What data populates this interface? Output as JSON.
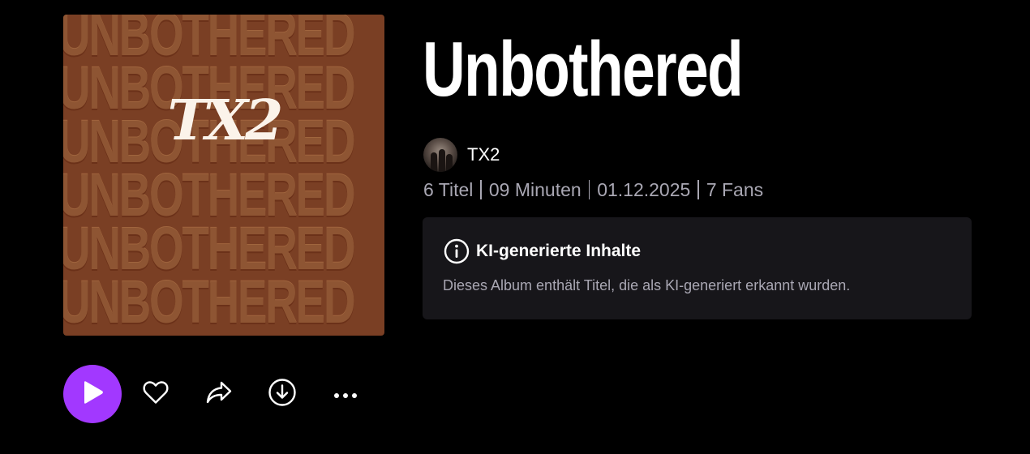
{
  "cover": {
    "pattern_word": "UNBOTHERED",
    "logo_text": "TX2",
    "background_color": "#7a3f24"
  },
  "album": {
    "title": "Unbothered"
  },
  "artist": {
    "name": "TX2"
  },
  "meta": {
    "tracks": "6 Titel",
    "duration": "09 Minuten",
    "release_date": "01.12.2025",
    "fans": "7 Fans"
  },
  "ai_notice": {
    "icon": "info-icon",
    "title": "KI-generierte Inhalte",
    "text": "Dieses Album enthält Titel, die als KI-generiert erkannt wurden."
  },
  "actions": {
    "play_icon": "play-icon",
    "like_icon": "heart-icon",
    "share_icon": "share-icon",
    "download_icon": "download-icon",
    "more_icon": "more-icon",
    "accent_color": "#a238ff"
  }
}
